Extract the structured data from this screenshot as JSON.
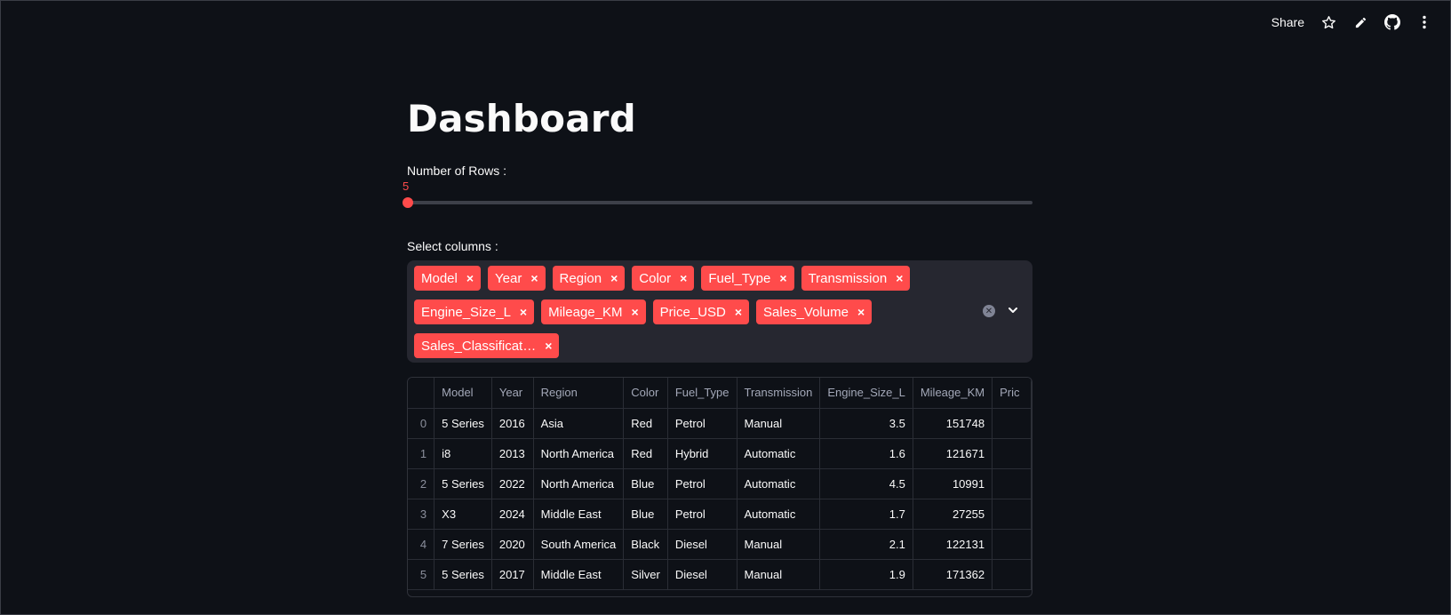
{
  "toolbar": {
    "share_label": "Share",
    "star_icon": "star-icon",
    "edit_icon": "pencil-icon",
    "github_icon": "github-icon",
    "menu_icon": "kebab-menu-icon"
  },
  "page": {
    "title": "Dashboard"
  },
  "slider": {
    "label": "Number of Rows :",
    "value": "5",
    "fraction": 0
  },
  "multiselect": {
    "label": "Select columns :",
    "tags": [
      "Model",
      "Year",
      "Region",
      "Color",
      "Fuel_Type",
      "Transmission",
      "Engine_Size_L",
      "Mileage_KM",
      "Price_USD",
      "Sales_Volume",
      "Sales_Classificat…"
    ],
    "remove_glyph": "×",
    "clear_icon": "clear-circle-icon",
    "dropdown_icon": "chevron-down-icon"
  },
  "table": {
    "columns": [
      "",
      "Model",
      "Year",
      "Region",
      "Color",
      "Fuel_Type",
      "Transmission",
      "Engine_Size_L",
      "Mileage_KM",
      "Pric"
    ],
    "rows": [
      [
        "0",
        "5 Series",
        "2016",
        "Asia",
        "Red",
        "Petrol",
        "Manual",
        "3.5",
        "151748",
        ""
      ],
      [
        "1",
        "i8",
        "2013",
        "North America",
        "Red",
        "Hybrid",
        "Automatic",
        "1.6",
        "121671",
        ""
      ],
      [
        "2",
        "5 Series",
        "2022",
        "North America",
        "Blue",
        "Petrol",
        "Automatic",
        "4.5",
        "10991",
        ""
      ],
      [
        "3",
        "X3",
        "2024",
        "Middle East",
        "Blue",
        "Petrol",
        "Automatic",
        "1.7",
        "27255",
        ""
      ],
      [
        "4",
        "7 Series",
        "2020",
        "South America",
        "Black",
        "Diesel",
        "Manual",
        "2.1",
        "122131",
        ""
      ],
      [
        "5",
        "5 Series",
        "2017",
        "Middle East",
        "Silver",
        "Diesel",
        "Manual",
        "1.9",
        "171362",
        ""
      ]
    ]
  },
  "colors": {
    "background": "#0e1117",
    "accent": "#ff4b4b",
    "input_bg": "#262730"
  }
}
